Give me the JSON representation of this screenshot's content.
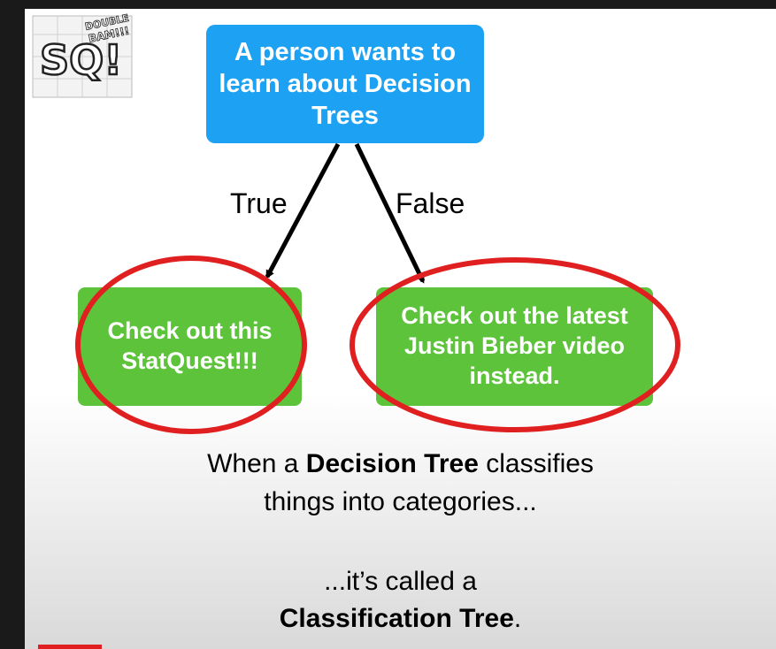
{
  "logo": {
    "main": "SQ!",
    "badge": "DOUBLE BAM!!!",
    "icon": "statquest-logo-icon"
  },
  "root_node": {
    "pre": "A person wants to learn about ",
    "bold": "Decision Trees"
  },
  "edges": {
    "left": "True",
    "right": "False"
  },
  "leaves": {
    "left": "Check out this StatQuest!!!",
    "right": "Check out the latest Justin Bieber video instead."
  },
  "caption": {
    "line1_pre": "When a ",
    "line1_bold": "Decision Tree",
    "line1_post": " classifies",
    "line2": "things into categories...",
    "line3": "...it’s called a",
    "line4_bold": "Classification Tree",
    "line4_post": "."
  },
  "colors": {
    "root": "#1da1f2",
    "leaf": "#5cc33a",
    "highlight": "#e02020"
  }
}
